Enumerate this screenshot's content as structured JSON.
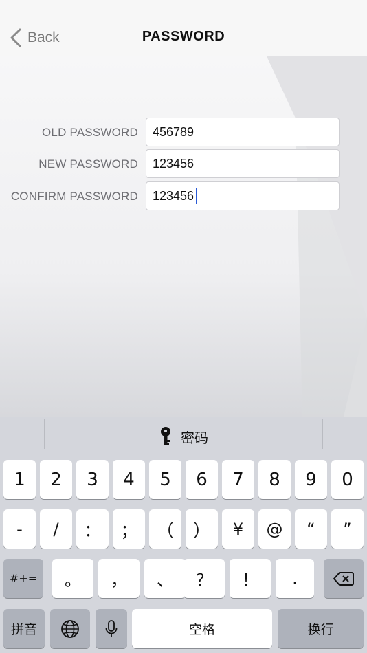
{
  "nav": {
    "back_label": "Back",
    "title": "PASSWORD"
  },
  "form": {
    "old": {
      "label": "OLD PASSWORD",
      "value": "456789"
    },
    "new": {
      "label": "NEW PASSWORD",
      "value": "123456"
    },
    "confirm": {
      "label": "CONFIRM PASSWORD",
      "value": "123456"
    }
  },
  "keyboard": {
    "suggestion": "密码",
    "row1": [
      "1",
      "2",
      "3",
      "4",
      "5",
      "6",
      "7",
      "8",
      "9",
      "0"
    ],
    "row2": [
      "-",
      "/",
      "：",
      "；",
      "（",
      "）",
      "¥",
      "@",
      "“",
      "”"
    ],
    "row3": [
      "。",
      "，",
      "、",
      "？",
      "！",
      "."
    ],
    "symbols_toggle": "#+=",
    "pinyin_toggle": "拼音",
    "space_label": "空格",
    "return_label": "换行"
  },
  "colors": {
    "caret": "#2b5bd6",
    "key_bg": "#ffffff",
    "key_dark_bg": "#aeb2bb",
    "keyboard_bg": "#d4d6dc"
  }
}
